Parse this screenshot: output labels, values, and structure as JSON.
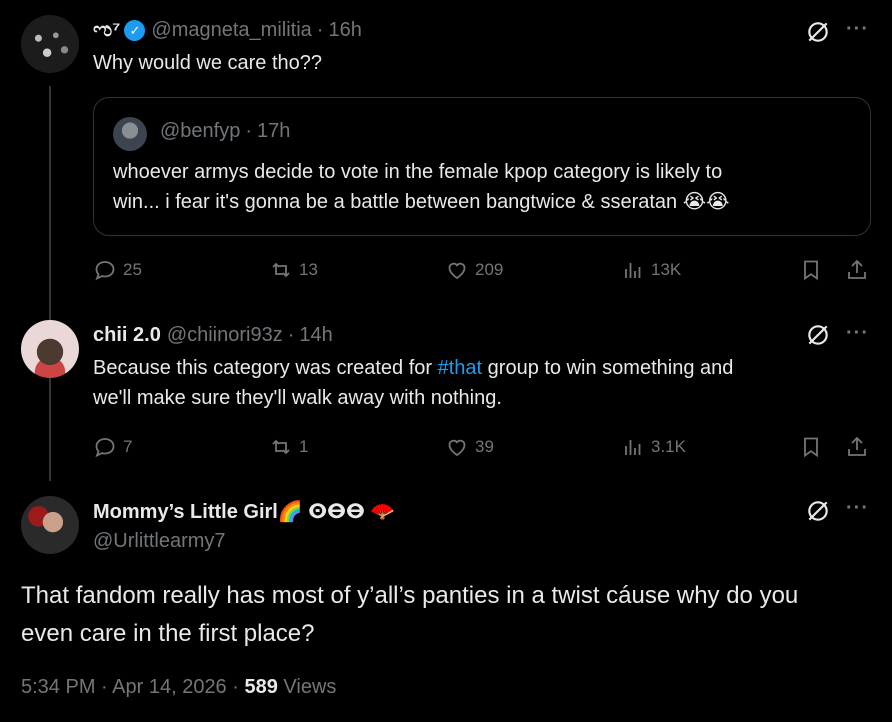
{
  "tweet1": {
    "display_name": "ಌ⁷",
    "handle": "@magneta_militia",
    "sep": "·",
    "time": "16h",
    "text": "Why would we care tho??",
    "quote": {
      "handle": "@benfyp",
      "sep": "·",
      "time": "17h",
      "text_line1": "whoever armys decide to vote in the female kpop category is likely to",
      "text_line2": "win... i fear it's gonna be a battle between bangtwice & sseratan 😭😭"
    },
    "replies": "25",
    "reposts": "13",
    "likes": "209",
    "views": "13K",
    "more": "···"
  },
  "tweet2": {
    "display_name": "chii 2.0",
    "handle": "@chiinori93z",
    "sep": "·",
    "time": "14h",
    "text_pre": "Because this category was created for ",
    "text_link": "#that",
    "text_post": " group to win something and",
    "text_line2": "we'll make sure they'll walk away with nothing.",
    "replies": "7",
    "reposts": "1",
    "likes": "39",
    "views": "3.1K",
    "more": "···"
  },
  "tweet3": {
    "display_name": "Mommy’s Little Girl🌈 ⵙⴱⴱ 🪭",
    "handle": "@Urlittlearmy7",
    "text_line1": "That fandom really has most of y’all’s panties in a twist cáuse why do you",
    "text_line2": "even care in the first place?",
    "timestamp": "5:34 PM · Apr 14, 2026 · ",
    "views_count": "589",
    "views_label": " Views",
    "more": "···"
  },
  "colors": {
    "background": "#000000",
    "text": "#e7e9ea",
    "muted": "#71767b",
    "accent": "#1d9bf0",
    "border": "#2f3336"
  }
}
